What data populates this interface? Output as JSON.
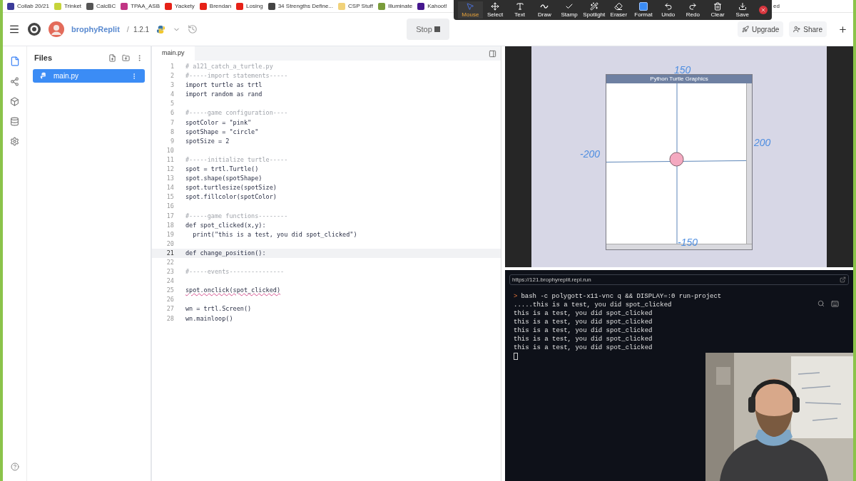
{
  "bookmarks": [
    {
      "label": "Collab 20/21",
      "color": "#3c3c9a"
    },
    {
      "label": "Trinket",
      "color": "#c6d43a"
    },
    {
      "label": "CalcBC",
      "color": "#555555"
    },
    {
      "label": "TPAA_ASB",
      "color": "#c13584"
    },
    {
      "label": "Yackety",
      "color": "#e62117"
    },
    {
      "label": "Brendan",
      "color": "#e62117"
    },
    {
      "label": "Losing",
      "color": "#e62117"
    },
    {
      "label": "34 Strengths Define...",
      "color": "#444444"
    },
    {
      "label": "CSP Stuff",
      "color": "#f1d27a"
    },
    {
      "label": "Illuminate",
      "color": "#7a9c3a"
    },
    {
      "label": "Kahoot!",
      "color": "#46178f"
    }
  ],
  "covered_bookmark": {
    "label": "ed"
  },
  "annotation_toolbar": {
    "tools": [
      {
        "label": "Mouse",
        "selected": true
      },
      {
        "label": "Select",
        "selected": false
      },
      {
        "label": "Text",
        "selected": false
      },
      {
        "label": "Draw",
        "selected": false
      },
      {
        "label": "Stamp",
        "selected": false
      },
      {
        "label": "Spotlight",
        "selected": false
      },
      {
        "label": "Eraser",
        "selected": false
      },
      {
        "label": "Format",
        "selected": false
      },
      {
        "label": "Undo",
        "selected": false
      },
      {
        "label": "Redo",
        "selected": false
      },
      {
        "label": "Clear",
        "selected": false
      },
      {
        "label": "Save",
        "selected": false
      }
    ]
  },
  "header": {
    "user": "brophyReplit",
    "separator": "/",
    "version": "1.2.1",
    "stop_button": "Stop",
    "upgrade_button": "Upgrade",
    "share_button": "Share"
  },
  "files_panel": {
    "title": "Files",
    "files": [
      {
        "name": "main.py",
        "selected": true
      }
    ]
  },
  "editor": {
    "tab": "main.py",
    "lines": [
      {
        "number": "1",
        "kind": "comment",
        "text": "# a121_catch_a_turtle.py",
        "selected": false
      },
      {
        "number": "2",
        "kind": "comment",
        "text": "#-----import statements-----",
        "selected": false
      },
      {
        "number": "3",
        "kind": "code",
        "text": "import turtle as trtl",
        "selected": false
      },
      {
        "number": "4",
        "kind": "code",
        "text": "import random as rand",
        "selected": false
      },
      {
        "number": "5",
        "kind": "blank",
        "selected": false
      },
      {
        "number": "6",
        "kind": "comment",
        "text": "#-----game configuration----",
        "selected": false
      },
      {
        "number": "7",
        "kind": "code",
        "text": "spotColor = \"pink\"",
        "selected": false
      },
      {
        "number": "8",
        "kind": "code",
        "text": "spotShape = \"circle\"",
        "selected": false
      },
      {
        "number": "9",
        "kind": "code",
        "text": "spotSize = 2",
        "selected": false
      },
      {
        "number": "10",
        "kind": "blank",
        "selected": false
      },
      {
        "number": "11",
        "kind": "comment",
        "text": "#-----initialize turtle-----",
        "selected": false
      },
      {
        "number": "12",
        "kind": "code",
        "text": "spot = trtl.Turtle()",
        "selected": false
      },
      {
        "number": "13",
        "kind": "code",
        "text": "spot.shape(spotShape)",
        "selected": false
      },
      {
        "number": "14",
        "kind": "code",
        "text": "spot.turtlesize(spotSize)",
        "selected": false
      },
      {
        "number": "15",
        "kind": "code",
        "text": "spot.fillcolor(spotColor)",
        "selected": false
      },
      {
        "number": "16",
        "kind": "blank",
        "selected": false
      },
      {
        "number": "17",
        "kind": "comment",
        "text": "#-----game functions--------",
        "selected": false
      },
      {
        "number": "18",
        "kind": "code",
        "text": "def spot_clicked(x,y):",
        "selected": false
      },
      {
        "number": "19",
        "kind": "code",
        "text": "  print(\"this is a test, you did spot_clicked\")",
        "selected": false
      },
      {
        "number": "20",
        "kind": "blank",
        "selected": false
      },
      {
        "number": "21",
        "kind": "code",
        "text": "def change_position():",
        "selected": true
      },
      {
        "number": "22",
        "kind": "blank",
        "selected": false
      },
      {
        "number": "23",
        "kind": "comment",
        "text": "#-----events---------------",
        "selected": false
      },
      {
        "number": "24",
        "kind": "blank",
        "selected": false
      },
      {
        "number": "25",
        "kind": "error",
        "text": "spot.onclick(spot_clicked)",
        "selected": false
      },
      {
        "number": "26",
        "kind": "blank",
        "selected": false
      },
      {
        "number": "27",
        "kind": "code",
        "text": "wn = trtl.Screen()",
        "selected": false
      },
      {
        "number": "28",
        "kind": "code",
        "text": "wn.mainloop()",
        "selected": false
      }
    ]
  },
  "output": {
    "window_title": "Python Turtle Graphics",
    "annotations": [
      "150",
      "-200",
      "200",
      "-150"
    ]
  },
  "terminal": {
    "url": "https://121.brophyreplit.repl.run",
    "prompt": ">",
    "command": "bash -c polygott-x11-vnc q && DISPLAY=:0 run-project",
    "lines": [
      ".....this is a test, you did spot_clicked",
      "this is a test, you did spot_clicked",
      "this is a test, you did spot_clicked",
      "this is a test, you did spot_clicked",
      "this is a test, you did spot_clicked",
      "this is a test, you did spot_clicked"
    ]
  }
}
